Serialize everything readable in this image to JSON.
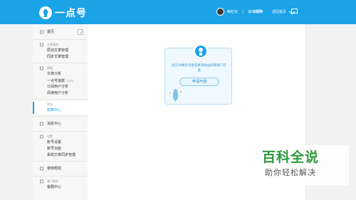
{
  "brand": {
    "name": "一点号"
  },
  "header": {
    "username": "韩旺论",
    "links": [
      "退出账号",
      "小程序",
      "返回首页"
    ]
  },
  "sidebar": {
    "home": "首页",
    "group_article": {
      "title": "文章管理",
      "items": [
        "原创文章管理",
        "同步文章管理"
      ]
    },
    "group_data": {
      "title": "数据",
      "items": [
        "文章分析",
        "一点号指数",
        "订阅用户分析",
        "阅读用户分析"
      ],
      "beta": "beta"
    },
    "group_revenue": {
      "title": "收益",
      "items": [
        "结算中心"
      ]
    },
    "messages": "消息中心",
    "group_settings": {
      "title": "设置",
      "items": [
        "账号设置",
        "账号功能",
        "系统文章同步管理"
      ]
    },
    "feedback": "使用帮助",
    "group_service": {
      "title": "客户服务",
      "items": [
        "客服中心"
      ]
    }
  },
  "main": {
    "card_text": "此页对拥有点金或更多收益权限用户开放",
    "apply_button": "申请开通"
  },
  "watermark": {
    "title": "百科全说",
    "subtitle": "助你轻松解决"
  },
  "colors": {
    "accent": "#1aa3e6",
    "watermark_green": "#2e9a3d"
  }
}
